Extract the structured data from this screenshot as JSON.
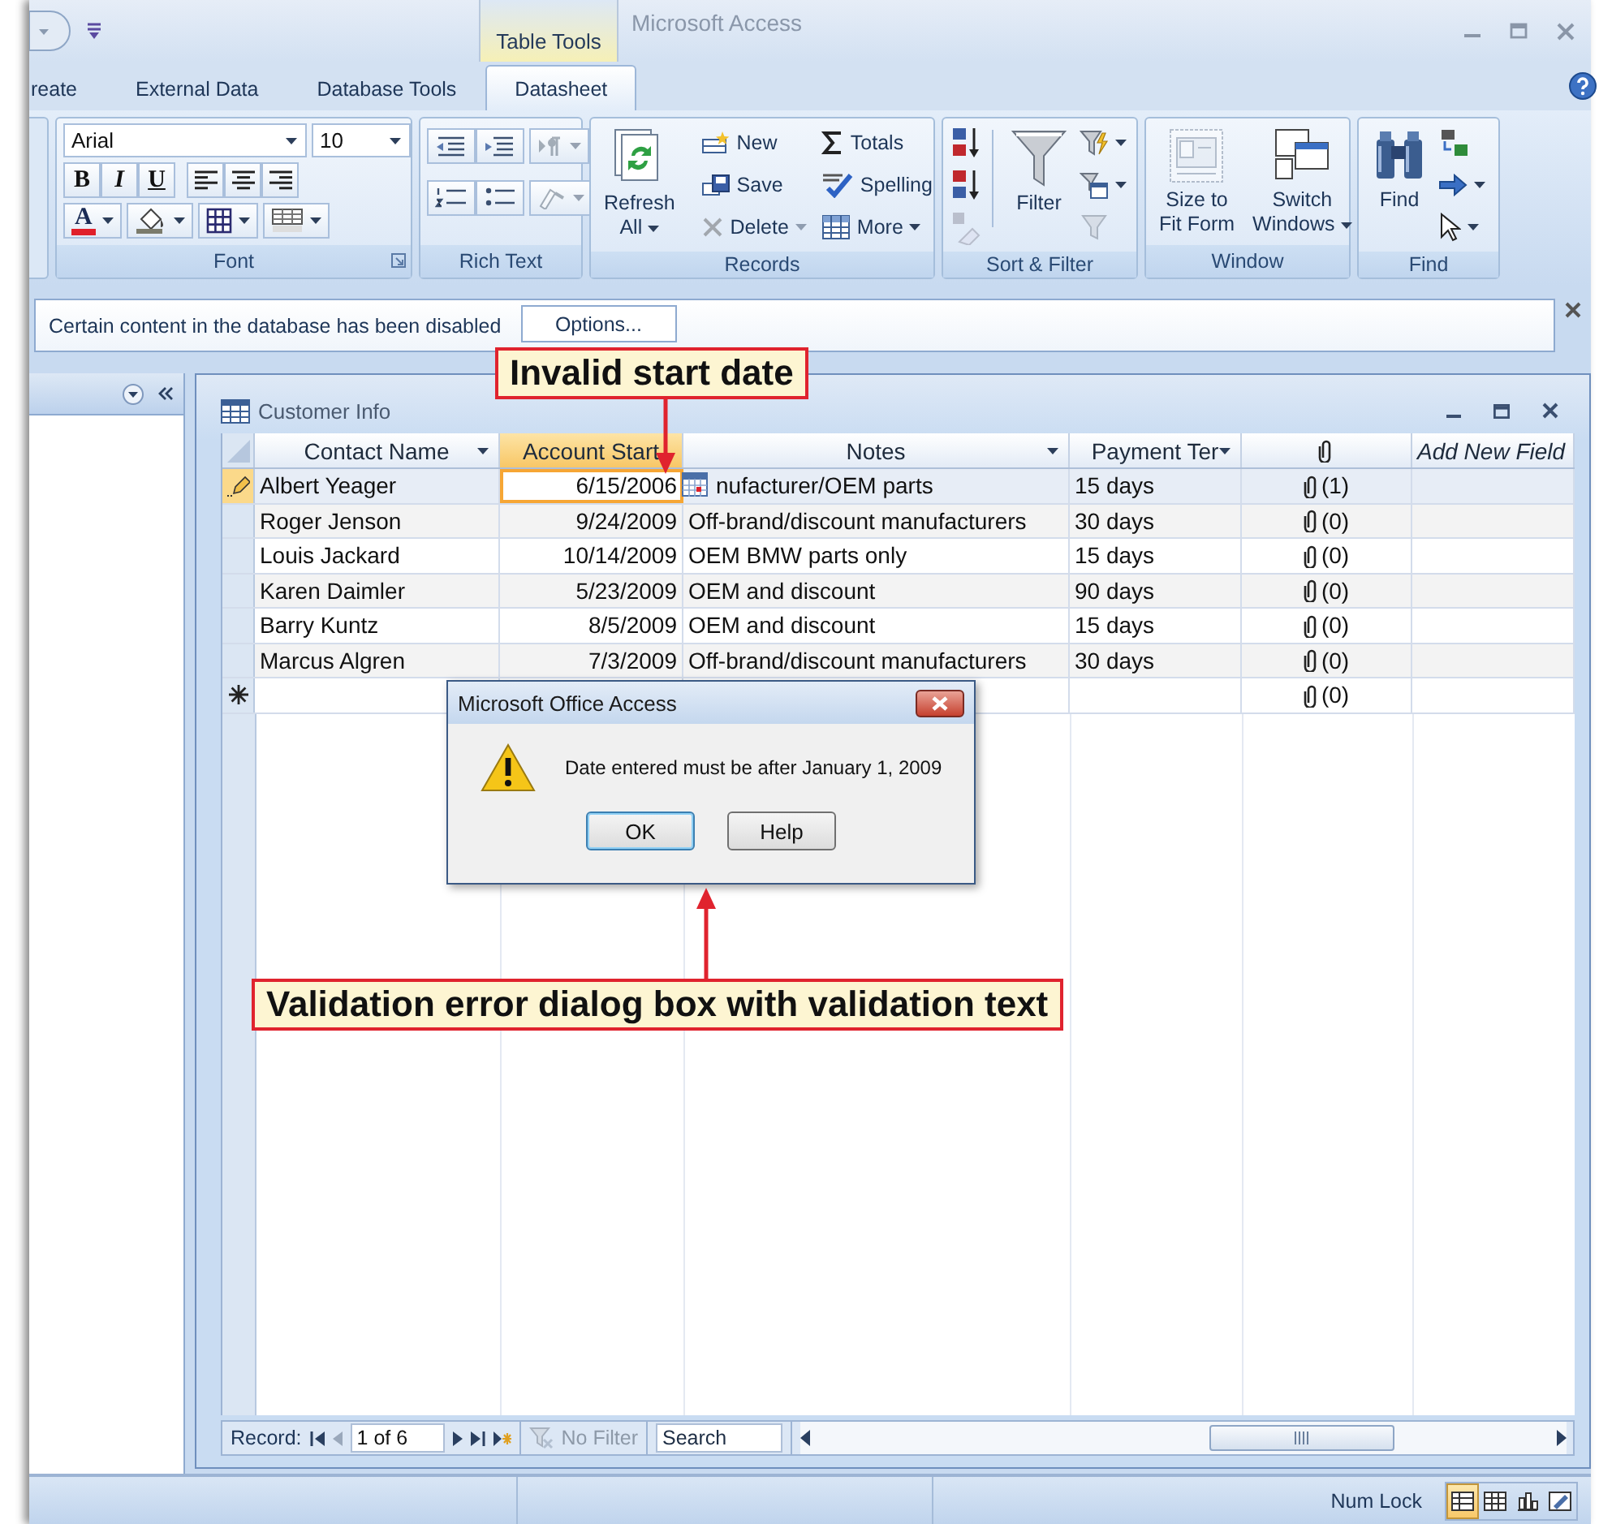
{
  "title_bar": {
    "contextual_tab": "Table Tools",
    "title": "Microsoft Access"
  },
  "ribbon_tabs": [
    {
      "label": "reate",
      "selected": false
    },
    {
      "label": "External Data",
      "selected": false
    },
    {
      "label": "Database Tools",
      "selected": false
    },
    {
      "label": "Datasheet",
      "selected": true
    }
  ],
  "font_group": {
    "label": "Font",
    "font": "Arial",
    "size": "10",
    "styles": [
      "B",
      "I",
      "U"
    ],
    "font_color": "A"
  },
  "rich_text_group": {
    "label": "Rich Text"
  },
  "records_group": {
    "label": "Records",
    "refresh": [
      "Refresh",
      "All"
    ],
    "buttons": [
      {
        "kind": "new",
        "label": "New",
        "disabled": false,
        "menu": false
      },
      {
        "kind": "save",
        "label": "Save",
        "disabled": false,
        "menu": false
      },
      {
        "kind": "delete",
        "label": "Delete",
        "disabled": true,
        "menu": true
      },
      {
        "kind": "totals",
        "label": "Totals",
        "disabled": false,
        "menu": false
      },
      {
        "kind": "spelling",
        "label": "Spelling",
        "disabled": false,
        "menu": false
      },
      {
        "kind": "more",
        "label": "More",
        "disabled": false,
        "menu": true
      }
    ]
  },
  "sort_filter_group": {
    "label": "Sort & Filter",
    "filter": "Filter"
  },
  "window_group": {
    "label": "Window",
    "buttons": [
      {
        "kind": "size_to_fit",
        "label": [
          "Size to",
          "Fit Form"
        ],
        "disabled": true,
        "menu": false
      },
      {
        "kind": "switch_windows",
        "label": [
          "Switch",
          "Windows"
        ],
        "disabled": false,
        "menu": true
      }
    ]
  },
  "find_group": {
    "label": "Find",
    "find": "Find"
  },
  "message_bar": {
    "text": "Certain content in the database has been disabled",
    "button": "Options..."
  },
  "datasheet": {
    "title": "Customer Info",
    "columns": [
      {
        "label": "Contact Name",
        "kind": "text",
        "menu": true,
        "selected": false
      },
      {
        "label": "Account Start",
        "kind": "date",
        "menu": false,
        "selected": true
      },
      {
        "label": "Notes",
        "kind": "text",
        "menu": true,
        "selected": false
      },
      {
        "label": "Payment Ter",
        "kind": "text",
        "menu": true,
        "selected": false
      },
      {
        "kind": "attachment",
        "menu": false,
        "selected": false
      },
      {
        "label": "Add New Field",
        "kind": "add",
        "menu": false,
        "selected": false
      }
    ],
    "rows": [
      {
        "kind": "editing",
        "selected": true,
        "cells": [
          "Albert Yeager",
          "6/15/2006",
          "nufacturer/OEM parts",
          "15 days",
          "(1)"
        ]
      },
      {
        "kind": "plain",
        "selected": false,
        "cells": [
          "Roger Jenson",
          "9/24/2009",
          "Off-brand/discount manufacturers",
          "30 days",
          "(0)"
        ]
      },
      {
        "kind": "plain",
        "selected": false,
        "cells": [
          "Louis Jackard",
          "10/14/2009",
          "OEM BMW parts only",
          "15 days",
          "(0)"
        ]
      },
      {
        "kind": "plain",
        "selected": false,
        "cells": [
          "Karen Daimler",
          "5/23/2009",
          "OEM and discount",
          "90 days",
          "(0)"
        ]
      },
      {
        "kind": "plain",
        "selected": false,
        "cells": [
          "Barry Kuntz",
          "8/5/2009",
          "OEM and discount",
          "15 days",
          "(0)"
        ]
      },
      {
        "kind": "plain",
        "selected": false,
        "cells": [
          "Marcus Algren",
          "7/3/2009",
          "Off-brand/discount manufacturers",
          "30 days",
          "(0)"
        ]
      },
      {
        "kind": "new",
        "selected": false,
        "cells": [
          null,
          null,
          null,
          null,
          "(0)"
        ]
      }
    ]
  },
  "navigation": {
    "label": "Record:",
    "position": "1 of 6",
    "filter": "No Filter",
    "filter_disabled": true,
    "search_placeholder": "Search"
  },
  "dialog": {
    "title": "Microsoft Office Access",
    "message": "Date entered must be after January 1, 2009",
    "buttons": [
      {
        "label": "OK",
        "default": true
      },
      {
        "label": "Help",
        "default": false
      }
    ]
  },
  "status_bar": {
    "text": "Num Lock",
    "views": [
      {
        "kind": "datasheet",
        "selected": true
      },
      {
        "kind": "pivot_table",
        "selected": false
      },
      {
        "kind": "pivot_chart",
        "selected": false
      },
      {
        "kind": "design",
        "selected": false
      }
    ]
  },
  "callouts": [
    {
      "text": "Invalid start date"
    },
    {
      "text": "Validation error dialog box with validation text"
    }
  ]
}
